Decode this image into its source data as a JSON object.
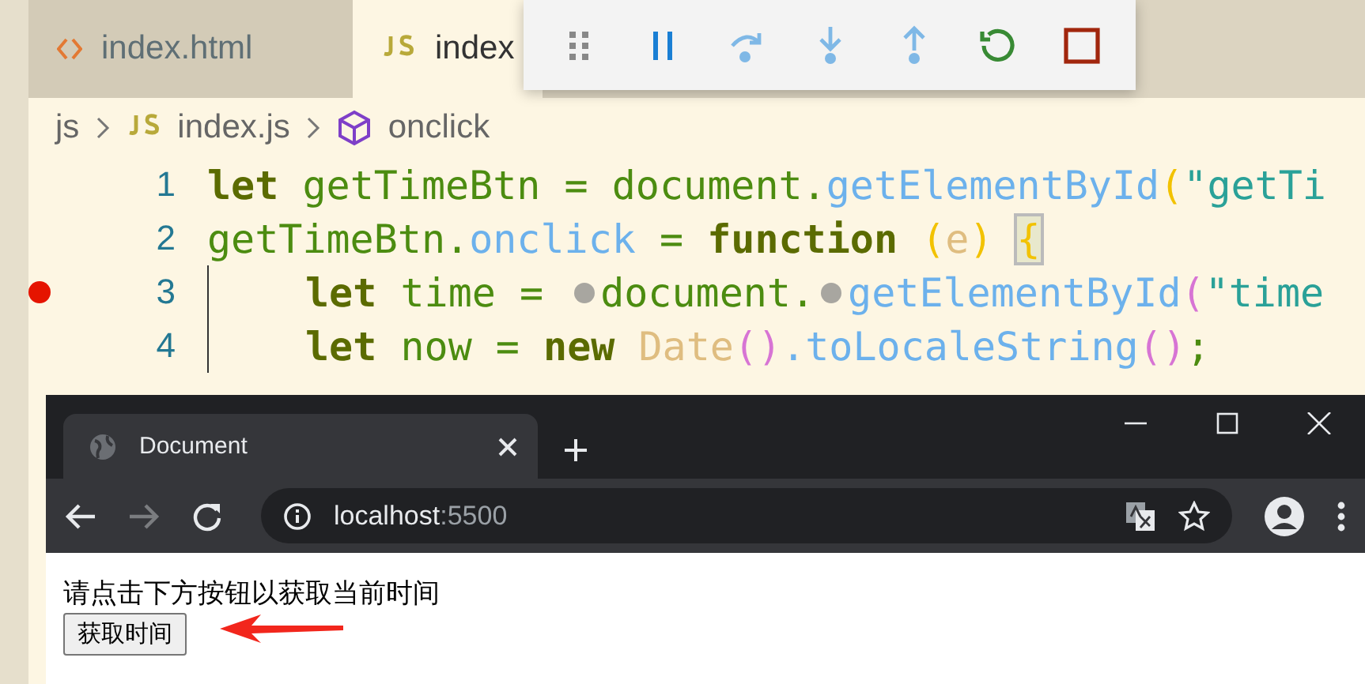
{
  "editor": {
    "tabs": [
      {
        "label": "index.html",
        "kind": "html",
        "selected": false
      },
      {
        "label": "index",
        "kind": "js",
        "selected": true
      }
    ],
    "breadcrumb": [
      {
        "label": "js",
        "kind": "folder"
      },
      {
        "label": "index.js",
        "kind": "js"
      },
      {
        "label": "onclick",
        "kind": "symbol"
      }
    ],
    "lines": [
      {
        "number": "1",
        "breakpoint": false,
        "indented": false,
        "tokens": [
          {
            "t": "let ",
            "kind": "keyword"
          },
          {
            "t": "getTimeBtn = document.",
            "kind": "ident"
          },
          {
            "t": "getElementById",
            "kind": "method"
          },
          {
            "t": "(",
            "kind": "paren"
          },
          {
            "t": "\"getTi",
            "kind": "string"
          }
        ]
      },
      {
        "number": "2",
        "breakpoint": false,
        "indented": false,
        "tokens": [
          {
            "t": "getTimeBtn.",
            "kind": "ident"
          },
          {
            "t": "onclick",
            "kind": "method"
          },
          {
            "t": " = ",
            "kind": "ident"
          },
          {
            "t": "function ",
            "kind": "keyword"
          },
          {
            "t": "(",
            "kind": "paren"
          },
          {
            "t": "e",
            "kind": "param"
          },
          {
            "t": ") ",
            "kind": "paren"
          },
          {
            "t": "{",
            "kind": "match"
          }
        ]
      },
      {
        "number": "3",
        "breakpoint": true,
        "indented": true,
        "tokens": [
          {
            "t": "let ",
            "kind": "keyword"
          },
          {
            "t": "time = ",
            "kind": "ident"
          },
          {
            "kind": "dot"
          },
          {
            "t": "document.",
            "kind": "ident"
          },
          {
            "kind": "dot"
          },
          {
            "t": "getElementById",
            "kind": "method"
          },
          {
            "t": "(",
            "kind": "paren2"
          },
          {
            "t": "\"time",
            "kind": "string"
          }
        ]
      },
      {
        "number": "4",
        "breakpoint": false,
        "indented": true,
        "tokens": [
          {
            "t": "let ",
            "kind": "keyword"
          },
          {
            "t": "now = ",
            "kind": "ident"
          },
          {
            "t": "new ",
            "kind": "keyword"
          },
          {
            "t": "Date",
            "kind": "param"
          },
          {
            "t": "()",
            "kind": "paren2"
          },
          {
            "t": ".toLocaleString",
            "kind": "method"
          },
          {
            "t": "()",
            "kind": "paren2"
          },
          {
            "t": ";",
            "kind": "ident"
          }
        ]
      }
    ]
  },
  "debug_toolbar": {
    "buttons": [
      {
        "kind": "grip"
      },
      {
        "kind": "pause"
      },
      {
        "kind": "step-over"
      },
      {
        "kind": "step-into"
      },
      {
        "kind": "step-out"
      },
      {
        "kind": "restart"
      },
      {
        "kind": "stop"
      }
    ]
  },
  "browser": {
    "tab": {
      "title": "Document"
    },
    "address": {
      "host": "localhost",
      "port": ":5500"
    },
    "nav": {
      "forward_disabled": true
    },
    "page": {
      "paragraph": "请点击下方按钮以获取当前时间",
      "button": "获取时间"
    }
  }
}
